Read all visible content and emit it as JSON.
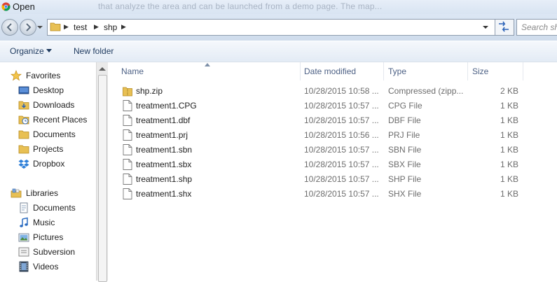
{
  "window": {
    "title": "Open",
    "background_text": "that analyze the area and can be launched from a demo page. The map..."
  },
  "address": {
    "crumbs": [
      "test",
      "shp"
    ],
    "search_placeholder": "Search shp"
  },
  "toolbar": {
    "organize_label": "Organize",
    "new_folder_label": "New folder"
  },
  "nav": {
    "favorites_label": "Favorites",
    "favorites": [
      {
        "label": "Desktop",
        "icon": "desktop-icon"
      },
      {
        "label": "Downloads",
        "icon": "downloads-folder-icon"
      },
      {
        "label": "Recent Places",
        "icon": "recent-places-icon"
      },
      {
        "label": "Documents",
        "icon": "folder-icon"
      },
      {
        "label": "Projects",
        "icon": "folder-icon"
      },
      {
        "label": "Dropbox",
        "icon": "dropbox-icon"
      }
    ],
    "libraries_label": "Libraries",
    "libraries": [
      {
        "label": "Documents",
        "icon": "documents-library-icon"
      },
      {
        "label": "Music",
        "icon": "music-icon"
      },
      {
        "label": "Pictures",
        "icon": "pictures-icon"
      },
      {
        "label": "Subversion",
        "icon": "subversion-icon"
      },
      {
        "label": "Videos",
        "icon": "videos-icon"
      }
    ]
  },
  "columns": {
    "name": "Name",
    "date": "Date modified",
    "type": "Type",
    "size": "Size"
  },
  "files": [
    {
      "name": "shp.zip",
      "date": "10/28/2015 10:58 ...",
      "type": "Compressed (zipp...",
      "size": "2 KB",
      "icon": "zip-folder-icon"
    },
    {
      "name": "treatment1.CPG",
      "date": "10/28/2015 10:57 ...",
      "type": "CPG File",
      "size": "1 KB",
      "icon": "file-icon"
    },
    {
      "name": "treatment1.dbf",
      "date": "10/28/2015 10:57 ...",
      "type": "DBF File",
      "size": "1 KB",
      "icon": "file-icon"
    },
    {
      "name": "treatment1.prj",
      "date": "10/28/2015 10:56 ...",
      "type": "PRJ File",
      "size": "1 KB",
      "icon": "file-icon"
    },
    {
      "name": "treatment1.sbn",
      "date": "10/28/2015 10:57 ...",
      "type": "SBN File",
      "size": "1 KB",
      "icon": "file-icon"
    },
    {
      "name": "treatment1.sbx",
      "date": "10/28/2015 10:57 ...",
      "type": "SBX File",
      "size": "1 KB",
      "icon": "file-icon"
    },
    {
      "name": "treatment1.shp",
      "date": "10/28/2015 10:57 ...",
      "type": "SHP File",
      "size": "1 KB",
      "icon": "file-icon"
    },
    {
      "name": "treatment1.shx",
      "date": "10/28/2015 10:57 ...",
      "type": "SHX File",
      "size": "1 KB",
      "icon": "file-icon"
    }
  ],
  "colors": {
    "chrome_bg": "#dfe9f5",
    "header_text": "#4d6185",
    "secondary_text": "#6d6d6d",
    "folder_yellow": "#e8c054"
  }
}
